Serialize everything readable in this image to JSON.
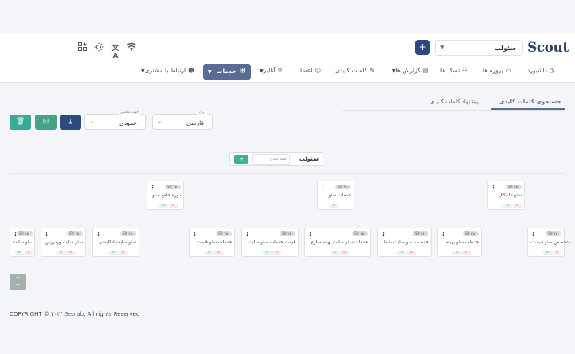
{
  "header": {
    "logo": "Scout",
    "project_select": "سئولب",
    "add_label": "+"
  },
  "nav": {
    "items": [
      {
        "label": "داشبورد"
      },
      {
        "label": "پروژه ها"
      },
      {
        "label": "تسک ها"
      },
      {
        "label": "گزارش ها"
      },
      {
        "label": "کلمات کلیدی"
      },
      {
        "label": "اعضا"
      },
      {
        "label": "آنالیز"
      },
      {
        "label": "خدمات"
      },
      {
        "label": "ارتباط با مشتری"
      }
    ]
  },
  "tabs": {
    "active": "جستجوی کلمات کلیدی",
    "other": "پیشنهاد کلمات کلیدی"
  },
  "filters": {
    "language_label": "زبان",
    "language_value": "فارسی",
    "direction_label": "جهت نمایش",
    "direction_value": "عمودی"
  },
  "tree": {
    "root": {
      "label": "سئولب",
      "placeholder": "کلمه کلیدی",
      "add": "+"
    },
    "level1": [
      {
        "keyword": "سئو تکنیکال",
        "sv": "SV: ۲۵۰",
        "green": "0",
        "red": "0"
      },
      {
        "keyword": "خدمات سئو",
        "sv": "SV: ۳۸۰",
        "green": "0",
        "red": ""
      },
      {
        "keyword": "دوره جامع سئو",
        "sv": "SV: ۲۵۰",
        "green": "0",
        "red": "0"
      }
    ],
    "level2": [
      {
        "keyword": "متخصص سئو چیست",
        "sv": "SV: ۲۵۰",
        "green": "0",
        "red": "0"
      },
      {
        "keyword": "خدمات سئو بهینه",
        "sv": "SV: ۲۵۰",
        "green": "0",
        "red": "0"
      },
      {
        "keyword": "خدمات سئو سایت شما",
        "sv": "SV: ۲۵۰",
        "green": "0",
        "red": "0"
      },
      {
        "keyword": "خدمات سئو سایت بهینه سازی",
        "sv": "SV: ۲۵۰",
        "green": "0",
        "red": "0"
      },
      {
        "keyword": "قیمت خدمات سئو سایت",
        "sv": "SV: ۲۵۰",
        "green": "0",
        "red": "0"
      },
      {
        "keyword": "خدمات سئو قیمت",
        "sv": "SV: ۲۵۰",
        "green": "0",
        "red": "0"
      },
      {
        "keyword": "سئو سایت انگلیسی",
        "sv": "SV: ۲۵۰",
        "green": "0",
        "red": "0"
      },
      {
        "keyword": "سئو سایت وردپرس",
        "sv": "SV: ۲۵۰",
        "green": "0",
        "red": "0"
      },
      {
        "keyword": "سئو سایت",
        "sv": "SV: ۲۵۰",
        "green": "0",
        "red": "0"
      }
    ]
  },
  "zoom": {
    "plus": "+",
    "minus": "−"
  },
  "footer": {
    "prefix": "COPYRIGHT © ۲۰۲۴ ",
    "brand": "Seolab",
    "suffix": ", All rights Reserved"
  },
  "colors": {
    "primary": "#2d4a7c",
    "accent": "#5a6b96",
    "green": "#3bb39b",
    "export": "#45a389",
    "delete": "#3aaa98"
  }
}
